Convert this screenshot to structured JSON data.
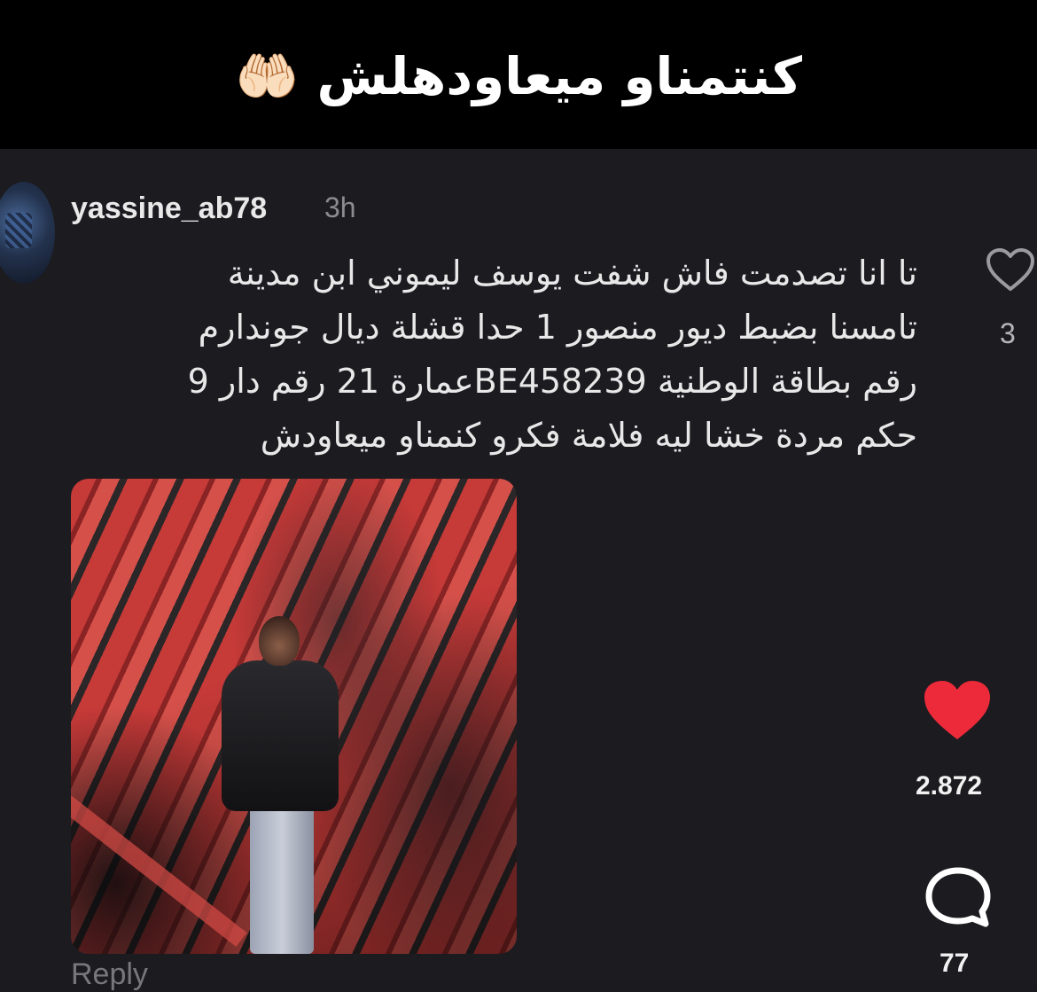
{
  "banner": {
    "text": "كنتمناو ميعاودهلش 🤲🏻"
  },
  "comment": {
    "username": "yassine_ab78",
    "time": "3h",
    "lines": [
      "تا انا تصدمت فاش شفت يوسف ليموني ابن مدينة",
      "تامسنا بضبط ديور منصور 1 حدا قشلة ديال جوندارم",
      "رقم بطاقة الوطنية BE458239عمارة 21 رقم دار 9",
      "حكم مردة خشا ليه فلامة فكرو كنمناو ميعاودش"
    ],
    "like_count": "3",
    "like_icon": "heart-outline-icon",
    "reply_label": "Reply"
  },
  "side_actions": {
    "like_icon": "heart-filled-icon",
    "like_count": "2.872",
    "comment_icon": "comment-bubble-icon",
    "comment_count": "77"
  },
  "colors": {
    "background": "#1c1b20",
    "banner_background": "#000000",
    "like_red": "#ed2a3a",
    "text_primary": "#e8e8e8",
    "text_secondary": "#8b8b90"
  }
}
